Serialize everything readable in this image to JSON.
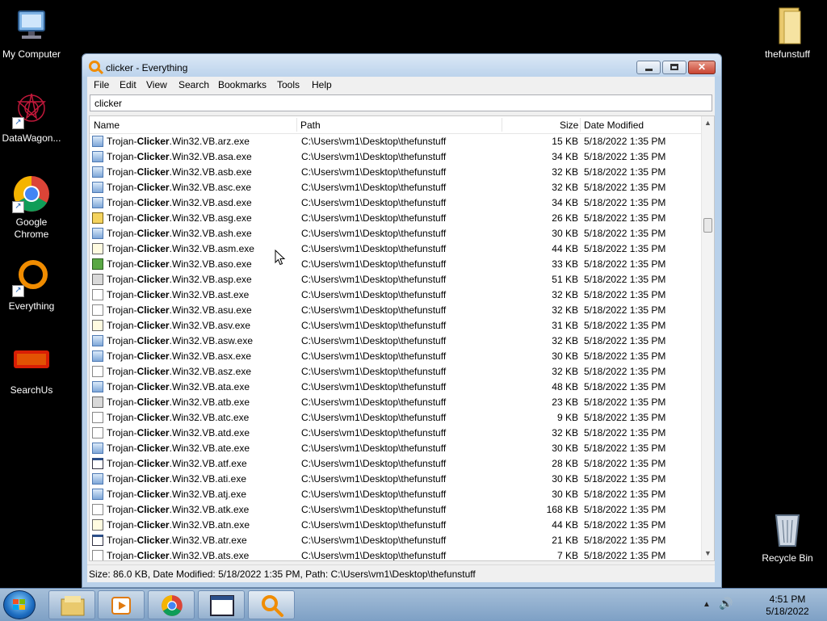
{
  "desktop": {
    "icons": [
      {
        "label": "My Computer"
      },
      {
        "label": "DataWagon..."
      },
      {
        "label": "Google Chrome"
      },
      {
        "label": "Everything"
      },
      {
        "label": "SearchUs"
      },
      {
        "label": "thefunstuff"
      },
      {
        "label": "Recycle Bin"
      }
    ]
  },
  "window": {
    "title": "clicker - Everything",
    "close_glyph": "✕",
    "menu": [
      "File",
      "Edit",
      "View",
      "Search",
      "Bookmarks",
      "Tools",
      "Help"
    ],
    "search": {
      "value": "clicker"
    },
    "columns": {
      "name": "Name",
      "path": "Path",
      "size": "Size",
      "date": "Date Modified"
    },
    "rows": [
      {
        "prefix": "Trojan-",
        "match": "Clicker",
        "suffix": ".Win32.VB.arz.exe",
        "path": "C:\\Users\\vm1\\Desktop\\thefunstuff",
        "size": "15 KB",
        "date": "5/18/2022 1:35 PM",
        "icon": "exe"
      },
      {
        "prefix": "Trojan-",
        "match": "Clicker",
        "suffix": ".Win32.VB.asa.exe",
        "path": "C:\\Users\\vm1\\Desktop\\thefunstuff",
        "size": "34 KB",
        "date": "5/18/2022 1:35 PM",
        "icon": "exe"
      },
      {
        "prefix": "Trojan-",
        "match": "Clicker",
        "suffix": ".Win32.VB.asb.exe",
        "path": "C:\\Users\\vm1\\Desktop\\thefunstuff",
        "size": "32 KB",
        "date": "5/18/2022 1:35 PM",
        "icon": "exe"
      },
      {
        "prefix": "Trojan-",
        "match": "Clicker",
        "suffix": ".Win32.VB.asc.exe",
        "path": "C:\\Users\\vm1\\Desktop\\thefunstuff",
        "size": "32 KB",
        "date": "5/18/2022 1:35 PM",
        "icon": "exe"
      },
      {
        "prefix": "Trojan-",
        "match": "Clicker",
        "suffix": ".Win32.VB.asd.exe",
        "path": "C:\\Users\\vm1\\Desktop\\thefunstuff",
        "size": "34 KB",
        "date": "5/18/2022 1:35 PM",
        "icon": "exe"
      },
      {
        "prefix": "Trojan-",
        "match": "Clicker",
        "suffix": ".Win32.VB.asg.exe",
        "path": "C:\\Users\\vm1\\Desktop\\thefunstuff",
        "size": "26 KB",
        "date": "5/18/2022 1:35 PM",
        "icon": "yellow"
      },
      {
        "prefix": "Trojan-",
        "match": "Clicker",
        "suffix": ".Win32.VB.ash.exe",
        "path": "C:\\Users\\vm1\\Desktop\\thefunstuff",
        "size": "30 KB",
        "date": "5/18/2022 1:35 PM",
        "icon": "exe"
      },
      {
        "prefix": "Trojan-",
        "match": "Clicker",
        "suffix": ".Win32.VB.asm.exe",
        "path": "C:\\Users\\vm1\\Desktop\\thefunstuff",
        "size": "44 KB",
        "date": "5/18/2022 1:35 PM",
        "icon": "note"
      },
      {
        "prefix": "Trojan-",
        "match": "Clicker",
        "suffix": ".Win32.VB.aso.exe",
        "path": "C:\\Users\\vm1\\Desktop\\thefunstuff",
        "size": "33 KB",
        "date": "5/18/2022 1:35 PM",
        "icon": "green"
      },
      {
        "prefix": "Trojan-",
        "match": "Clicker",
        "suffix": ".Win32.VB.asp.exe",
        "path": "C:\\Users\\vm1\\Desktop\\thefunstuff",
        "size": "51 KB",
        "date": "5/18/2022 1:35 PM",
        "icon": "gray"
      },
      {
        "prefix": "Trojan-",
        "match": "Clicker",
        "suffix": ".Win32.VB.ast.exe",
        "path": "C:\\Users\\vm1\\Desktop\\thefunstuff",
        "size": "32 KB",
        "date": "5/18/2022 1:35 PM",
        "icon": "blank"
      },
      {
        "prefix": "Trojan-",
        "match": "Clicker",
        "suffix": ".Win32.VB.asu.exe",
        "path": "C:\\Users\\vm1\\Desktop\\thefunstuff",
        "size": "32 KB",
        "date": "5/18/2022 1:35 PM",
        "icon": "blank"
      },
      {
        "prefix": "Trojan-",
        "match": "Clicker",
        "suffix": ".Win32.VB.asv.exe",
        "path": "C:\\Users\\vm1\\Desktop\\thefunstuff",
        "size": "31 KB",
        "date": "5/18/2022 1:35 PM",
        "icon": "note"
      },
      {
        "prefix": "Trojan-",
        "match": "Clicker",
        "suffix": ".Win32.VB.asw.exe",
        "path": "C:\\Users\\vm1\\Desktop\\thefunstuff",
        "size": "32 KB",
        "date": "5/18/2022 1:35 PM",
        "icon": "exe"
      },
      {
        "prefix": "Trojan-",
        "match": "Clicker",
        "suffix": ".Win32.VB.asx.exe",
        "path": "C:\\Users\\vm1\\Desktop\\thefunstuff",
        "size": "30 KB",
        "date": "5/18/2022 1:35 PM",
        "icon": "exe"
      },
      {
        "prefix": "Trojan-",
        "match": "Clicker",
        "suffix": ".Win32.VB.asz.exe",
        "path": "C:\\Users\\vm1\\Desktop\\thefunstuff",
        "size": "32 KB",
        "date": "5/18/2022 1:35 PM",
        "icon": "blank"
      },
      {
        "prefix": "Trojan-",
        "match": "Clicker",
        "suffix": ".Win32.VB.ata.exe",
        "path": "C:\\Users\\vm1\\Desktop\\thefunstuff",
        "size": "48 KB",
        "date": "5/18/2022 1:35 PM",
        "icon": "exe"
      },
      {
        "prefix": "Trojan-",
        "match": "Clicker",
        "suffix": ".Win32.VB.atb.exe",
        "path": "C:\\Users\\vm1\\Desktop\\thefunstuff",
        "size": "23 KB",
        "date": "5/18/2022 1:35 PM",
        "icon": "gray"
      },
      {
        "prefix": "Trojan-",
        "match": "Clicker",
        "suffix": ".Win32.VB.atc.exe",
        "path": "C:\\Users\\vm1\\Desktop\\thefunstuff",
        "size": "9 KB",
        "date": "5/18/2022 1:35 PM",
        "icon": "blank"
      },
      {
        "prefix": "Trojan-",
        "match": "Clicker",
        "suffix": ".Win32.VB.atd.exe",
        "path": "C:\\Users\\vm1\\Desktop\\thefunstuff",
        "size": "32 KB",
        "date": "5/18/2022 1:35 PM",
        "icon": "blank"
      },
      {
        "prefix": "Trojan-",
        "match": "Clicker",
        "suffix": ".Win32.VB.ate.exe",
        "path": "C:\\Users\\vm1\\Desktop\\thefunstuff",
        "size": "30 KB",
        "date": "5/18/2022 1:35 PM",
        "icon": "exe"
      },
      {
        "prefix": "Trojan-",
        "match": "Clicker",
        "suffix": ".Win32.VB.atf.exe",
        "path": "C:\\Users\\vm1\\Desktop\\thefunstuff",
        "size": "28 KB",
        "date": "5/18/2022 1:35 PM",
        "icon": "win"
      },
      {
        "prefix": "Trojan-",
        "match": "Clicker",
        "suffix": ".Win32.VB.ati.exe",
        "path": "C:\\Users\\vm1\\Desktop\\thefunstuff",
        "size": "30 KB",
        "date": "5/18/2022 1:35 PM",
        "icon": "exe"
      },
      {
        "prefix": "Trojan-",
        "match": "Clicker",
        "suffix": ".Win32.VB.atj.exe",
        "path": "C:\\Users\\vm1\\Desktop\\thefunstuff",
        "size": "30 KB",
        "date": "5/18/2022 1:35 PM",
        "icon": "exe"
      },
      {
        "prefix": "Trojan-",
        "match": "Clicker",
        "suffix": ".Win32.VB.atk.exe",
        "path": "C:\\Users\\vm1\\Desktop\\thefunstuff",
        "size": "168 KB",
        "date": "5/18/2022 1:35 PM",
        "icon": "blank"
      },
      {
        "prefix": "Trojan-",
        "match": "Clicker",
        "suffix": ".Win32.VB.atn.exe",
        "path": "C:\\Users\\vm1\\Desktop\\thefunstuff",
        "size": "44 KB",
        "date": "5/18/2022 1:35 PM",
        "icon": "note"
      },
      {
        "prefix": "Trojan-",
        "match": "Clicker",
        "suffix": ".Win32.VB.atr.exe",
        "path": "C:\\Users\\vm1\\Desktop\\thefunstuff",
        "size": "21 KB",
        "date": "5/18/2022 1:35 PM",
        "icon": "win"
      },
      {
        "prefix": "Trojan-",
        "match": "Clicker",
        "suffix": ".Win32.VB.ats.exe",
        "path": "C:\\Users\\vm1\\Desktop\\thefunstuff",
        "size": "7 KB",
        "date": "5/18/2022 1:35 PM",
        "icon": "blank"
      }
    ],
    "status": "Size: 86.0 KB, Date Modified: 5/18/2022 1:35 PM, Path: C:\\Users\\vm1\\Desktop\\thefunstuff"
  },
  "taskbar": {
    "buttons": [
      "explorer-icon",
      "media-player-icon",
      "chrome-icon",
      "window-icon",
      "everything-icon"
    ],
    "active_button": "everything-icon",
    "clock": {
      "time": "4:51 PM",
      "date": "5/18/2022"
    }
  }
}
